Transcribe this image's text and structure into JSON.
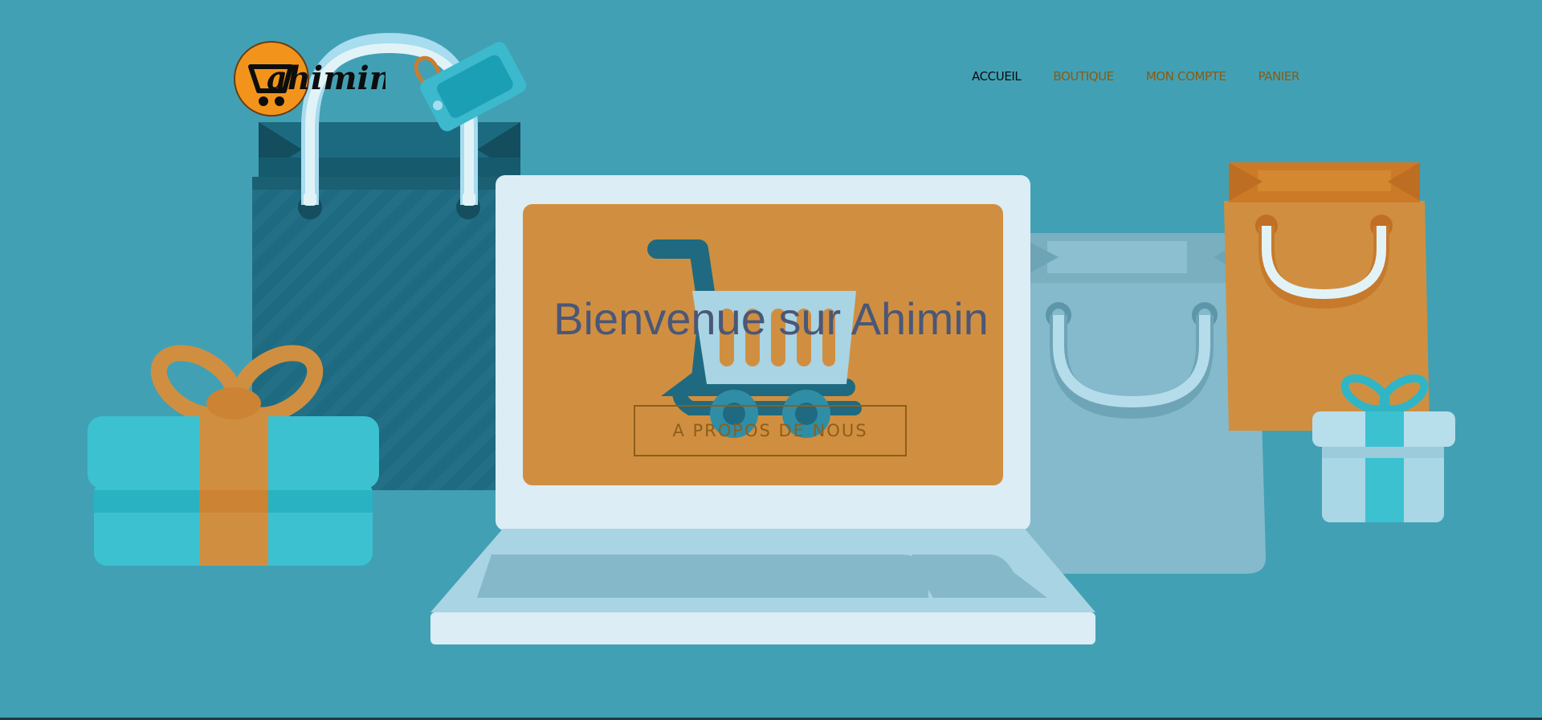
{
  "brand": {
    "logo_text": "ahimin",
    "logo_icon": "shopping-cart-logo"
  },
  "nav": {
    "items": [
      {
        "label": "ACCUEIL",
        "active": true
      },
      {
        "label": "BOUTIQUE",
        "active": false
      },
      {
        "label": "MON COMPTE",
        "active": false
      },
      {
        "label": "PANIER",
        "active": false
      }
    ]
  },
  "hero": {
    "title": "Bienvenue sur Ahimin",
    "button_label": "A PROPOS DE NOUS"
  },
  "colors": {
    "background": "#42a0b4",
    "accent_orange": "#d08f40",
    "nav_link": "#8a5a12",
    "nav_active": "#0d0d0d",
    "title": "#4b5777"
  }
}
